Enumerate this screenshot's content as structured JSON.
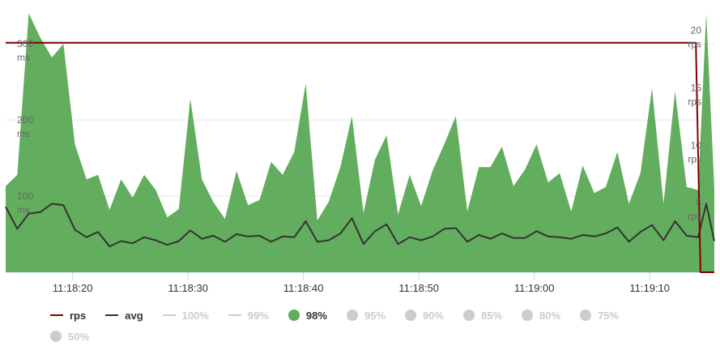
{
  "chart_data": {
    "type": "area",
    "x_tick_labels": [
      "11:18:20",
      "11:18:30",
      "11:18:40",
      "11:18:50",
      "11:19:00",
      "11:19:10"
    ],
    "left_axis": {
      "unit": "ms",
      "ticks": [
        100,
        200,
        300
      ],
      "ylim": [
        0,
        315
      ]
    },
    "right_axis": {
      "unit": "rps",
      "ticks": [
        5,
        10,
        15,
        20
      ],
      "ylim": [
        0,
        20.9
      ]
    },
    "x_range_seconds": [
      14.2,
      75.6
    ],
    "series": [
      {
        "name": "98%",
        "axis": "left",
        "style": "area",
        "color": "#63ad5e",
        "x": [
          14.2,
          15.2,
          16.2,
          17.2,
          18.2,
          19.2,
          20.2,
          21.2,
          22.2,
          23.2,
          24.2,
          25.2,
          26.2,
          27.2,
          28.2,
          29.2,
          30.2,
          31.2,
          32.2,
          33.2,
          34.2,
          35.2,
          36.2,
          37.2,
          38.2,
          39.2,
          40.2,
          41.2,
          42.2,
          43.2,
          44.2,
          45.2,
          46.2,
          47.2,
          48.2,
          49.2,
          50.2,
          51.2,
          52.2,
          53.2,
          54.2,
          55.2,
          56.2,
          57.2,
          58.2,
          59.2,
          60.2,
          61.2,
          62.2,
          63.2,
          64.2,
          65.2,
          66.2,
          67.2,
          68.2,
          69.2,
          70.2,
          71.2,
          72.2,
          73.2,
          74.2,
          74.9,
          75.6
        ],
        "values": [
          113,
          128,
          340,
          308,
          282,
          300,
          168,
          122,
          128,
          82,
          122,
          98,
          128,
          108,
          72,
          83,
          228,
          122,
          92,
          70,
          133,
          88,
          95,
          145,
          128,
          158,
          248,
          68,
          93,
          138,
          205,
          78,
          148,
          180,
          76,
          128,
          87,
          134,
          168,
          205,
          80,
          138,
          138,
          165,
          113,
          135,
          168,
          118,
          130,
          80,
          140,
          104,
          112,
          158,
          90,
          130,
          242,
          90,
          238,
          112,
          108,
          340,
          110
        ]
      },
      {
        "name": "avg",
        "axis": "left",
        "style": "line",
        "color": "#333333",
        "x": [
          14.2,
          15.2,
          16.2,
          17.2,
          18.2,
          19.2,
          20.2,
          21.2,
          22.2,
          23.2,
          24.2,
          25.2,
          26.2,
          27.2,
          28.2,
          29.2,
          30.2,
          31.2,
          32.2,
          33.2,
          34.2,
          35.2,
          36.2,
          37.2,
          38.2,
          39.2,
          40.2,
          41.2,
          42.2,
          43.2,
          44.2,
          45.2,
          46.2,
          47.2,
          48.2,
          49.2,
          50.2,
          51.2,
          52.2,
          53.2,
          54.2,
          55.2,
          56.2,
          57.2,
          58.2,
          59.2,
          60.2,
          61.2,
          62.2,
          63.2,
          64.2,
          65.2,
          66.2,
          67.2,
          68.2,
          69.2,
          70.2,
          71.2,
          72.2,
          73.2,
          74.2,
          74.9,
          75.6
        ],
        "values": [
          86,
          57,
          77,
          79,
          90,
          88,
          56,
          46,
          53,
          34,
          41,
          38,
          46,
          42,
          36,
          41,
          55,
          44,
          48,
          40,
          50,
          47,
          48,
          40,
          47,
          46,
          67,
          40,
          42,
          51,
          71,
          37,
          54,
          63,
          37,
          46,
          42,
          47,
          57,
          58,
          40,
          49,
          44,
          51,
          45,
          45,
          54,
          47,
          46,
          44,
          49,
          47,
          51,
          59,
          40,
          53,
          62,
          42,
          67,
          48,
          46,
          90,
          41
        ]
      },
      {
        "name": "rps",
        "axis": "right",
        "style": "line",
        "color": "#800000",
        "x": [
          14.2,
          74.0,
          74.4,
          75.6
        ],
        "values": [
          20.0,
          20.0,
          0,
          0
        ]
      }
    ],
    "legend": [
      {
        "label": "rps",
        "symbol": "line",
        "color": "#800000",
        "enabled": true
      },
      {
        "label": "avg",
        "symbol": "line",
        "color": "#333333",
        "enabled": true
      },
      {
        "label": "100%",
        "symbol": "line",
        "color": "#cccccc",
        "enabled": false
      },
      {
        "label": "99%",
        "symbol": "line",
        "color": "#cccccc",
        "enabled": false
      },
      {
        "label": "98%",
        "symbol": "dot",
        "color": "#63ad5e",
        "enabled": true
      },
      {
        "label": "95%",
        "symbol": "dot",
        "color": "#cccccc",
        "enabled": false
      },
      {
        "label": "90%",
        "symbol": "dot",
        "color": "#cccccc",
        "enabled": false
      },
      {
        "label": "85%",
        "symbol": "dot",
        "color": "#cccccc",
        "enabled": false
      },
      {
        "label": "80%",
        "symbol": "dot",
        "color": "#cccccc",
        "enabled": false
      },
      {
        "label": "75%",
        "symbol": "dot",
        "color": "#cccccc",
        "enabled": false
      },
      {
        "label": "50%",
        "symbol": "dot",
        "color": "#cccccc",
        "enabled": false
      }
    ],
    "legend_position": "bottom",
    "grid": true
  }
}
